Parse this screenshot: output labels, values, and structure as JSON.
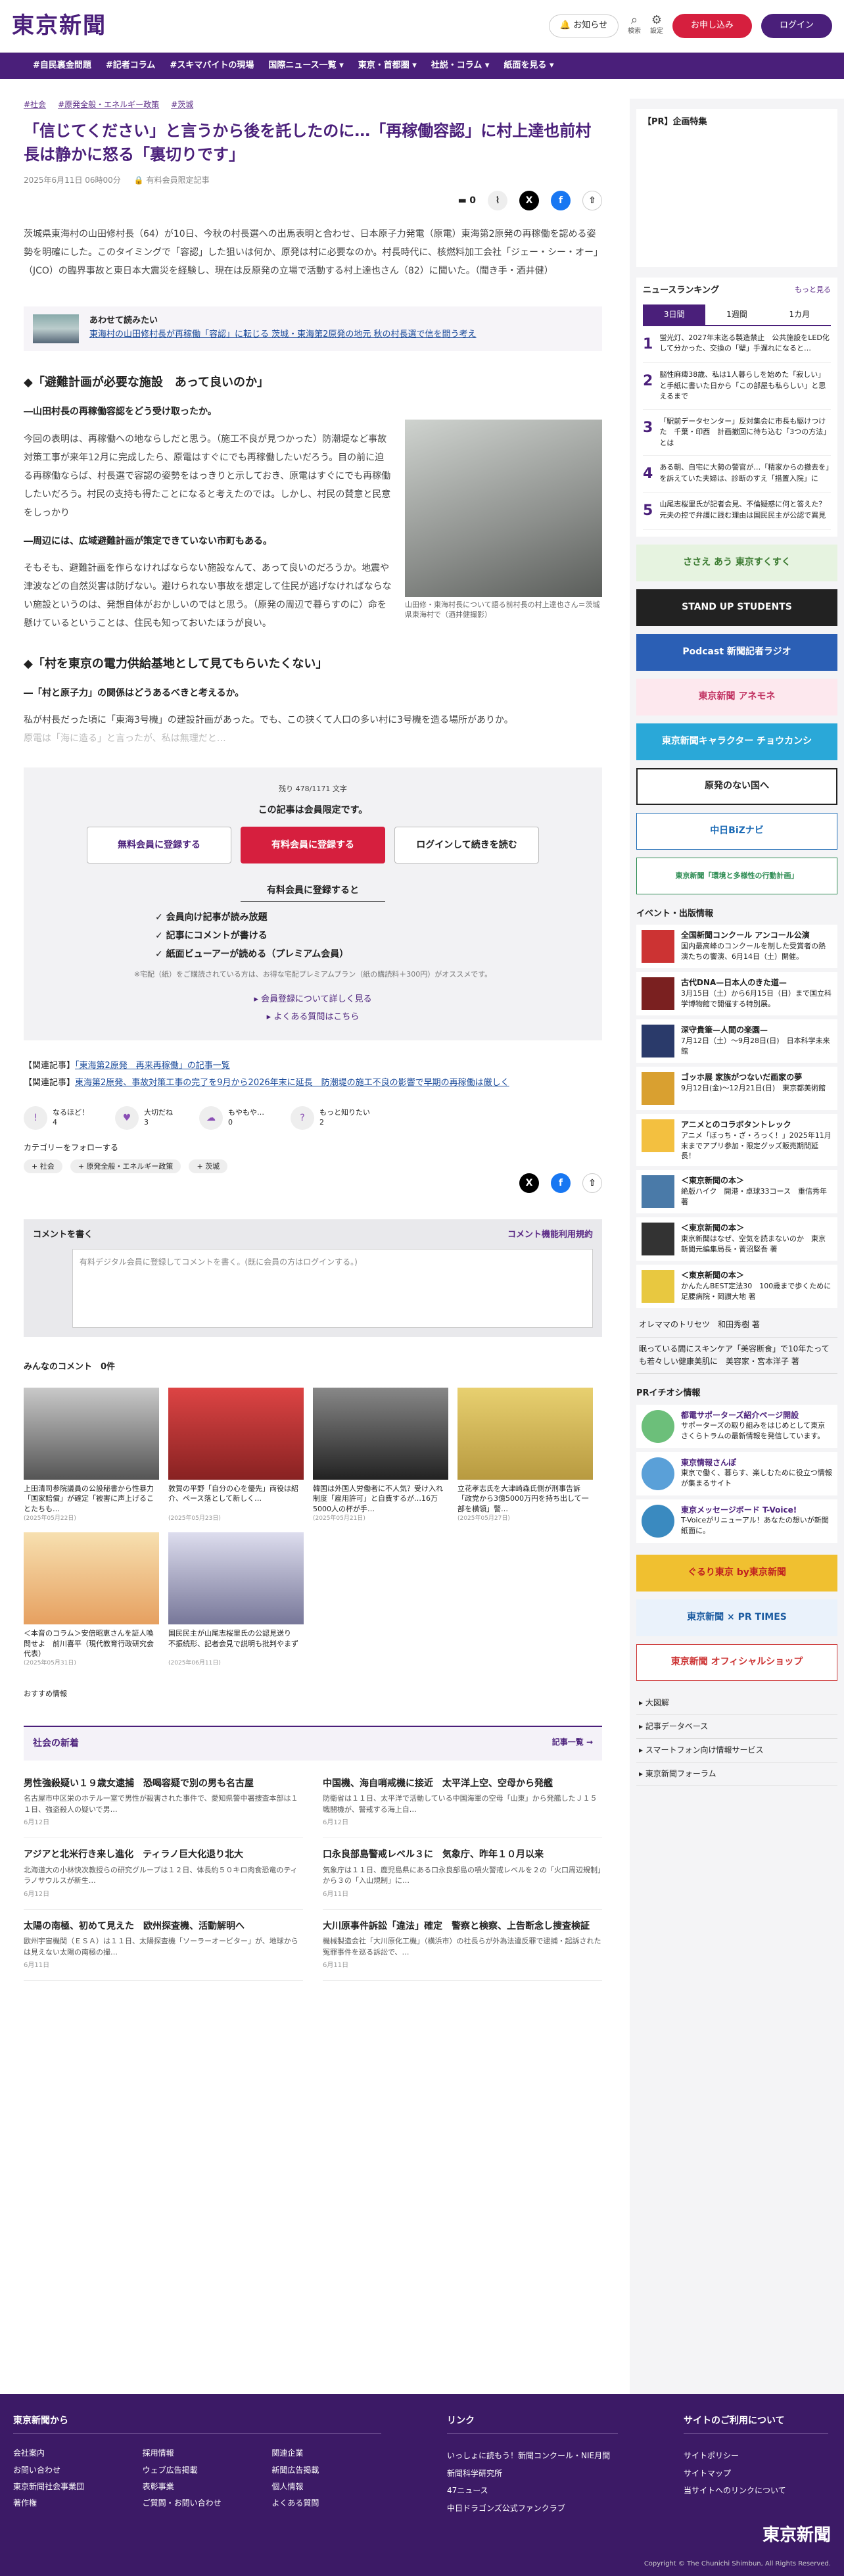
{
  "header": {
    "logo": "東京新聞",
    "notice": "お知らせ",
    "search": "検索",
    "settings": "設定",
    "register": "お申し込み",
    "login": "ログイン"
  },
  "nav": [
    "#自民裏金問題",
    "#記者コラム",
    "#スキマバイトの現場",
    "国際ニュース一覧 ▾",
    "東京・首都圏 ▾",
    "社説・コラム ▾",
    "紙面を見る ▾"
  ],
  "article": {
    "tags": [
      "#社会",
      "#原発全般・エネルギー政策",
      "#茨城"
    ],
    "title": "「信じてください」と言うから後を託したのに…「再稼働容認」に村上達也前村長は静かに怒る「裏切りです」",
    "date": "2025年6月11日 06時00分",
    "badge": "有料会員限定記事",
    "comment_count": "0",
    "lead": "茨城県東海村の山田修村長（64）が10日、今秋の村長選への出馬表明と合わせ、日本原子力発電（原電）東海第2原発の再稼働を認める姿勢を明確にした。このタイミングで「容認」した狙いは何か、原発は村に必要なのか。村長時代に、核燃料加工会社「ジェー・シー・オー」（JCO）の臨界事故と東日本大震災を経験し、現在は反原発の立場で活動する村上達也さん（82）に聞いた。（聞き手・酒井健）",
    "related_label": "あわせて読みたい",
    "related_title": "東海村の山田修村長が再稼働「容認」に転じる 茨城・東海第2原発の地元 秋の村長選で信を問う考え",
    "h2a": "◆「避難計画が必要な施設　あって良いのか」",
    "q1": "―山田村長の再稼働容認をどう受け取ったか。",
    "p1": "今回の表明は、再稼働への地ならしだと思う。（施工不良が見つかった）防潮堤など事故対策工事が来年12月に完成したら、原電はすぐにでも再稼働したいだろう。目の前に迫る再稼働ならば、村長選で容認の姿勢をはっきりと示しておき、原電はすぐにでも再稼働したいだろう。村民の支持も得たことになると考えたのでは。しかし、村民の賛意と民意をしっかり",
    "q2": "―周辺には、広域避難計画が策定できていない市町もある。",
    "p2": "そもそも、避難計画を作らなければならない施設なんて、あって良いのだろうか。地震や津波などの自然災害は防げない。避けられない事故を想定して住民が逃げなければならない施設というのは、発想自体がおかしいのではと思う。（原発の周辺で暮らすのに）命を懸けているということは、住民も知っておいたほうが良い。",
    "photo_caption": "山田修・東海村長について語る前村長の村上達也さん＝茨城県東海村で（酒井健撮影）",
    "h2b": "◆「村を東京の電力供給基地として見てもらいたくない」",
    "q3": "―「村と原子力」の関係はどうあるべきと考えるか。",
    "p3": "私が村長だった頃に「東海3号機」の建設計画があった。でも、この狭くて人口の多い村に3号機を造る場所がありか。",
    "p3_fade": "原電は「海に造る」と言ったが、私は無理だと…"
  },
  "paywall": {
    "remaining": "残り 478/1171 文字",
    "msg": "この記事は会員限定です。",
    "btn_free": "無料会員に登録する",
    "btn_paid": "有料会員に登録する",
    "btn_login": "ログインして続きを読む",
    "benefits_h": "有料会員に登録すると",
    "benefits": [
      "会員向け記事が読み放題",
      "記事にコメントが書ける",
      "紙面ビューアーが読める（プレミアム会員）"
    ],
    "note": "※宅配（紙）をご購読されている方は、お得な宅配プレミアムプラン（紙の購読料＋300円）がオススメです。",
    "link1": "会員登録について詳しく見る",
    "link2": "よくある質問はこちら"
  },
  "related_articles": {
    "a_label": "【関連記事】",
    "a_text": "「東海第2原発　再来再稼働」の記事一覧",
    "b_label": "【関連記事】",
    "b_text": "東海第2原発、事故対策工事の完了を9月から2026年末に延長　防潮堤の施工不良の影響で早期の再稼働は厳しく"
  },
  "reactions": [
    {
      "label": "なるほど！",
      "count": "4"
    },
    {
      "label": "大切だね",
      "count": "3"
    },
    {
      "label": "もやもや…",
      "count": "0"
    },
    {
      "label": "もっと知りたい",
      "count": "2"
    }
  ],
  "follow": {
    "heading": "カテゴリーをフォローする",
    "chips": [
      "社会",
      "原発全般・エネルギー政策",
      "茨城"
    ]
  },
  "comment": {
    "heading": "コメントを書く",
    "policy": "コメント機能利用規約",
    "placeholder": "有料デジタル会員に登録してコメントを書く。(既に会員の方はログインする。)"
  },
  "mycomments": {
    "heading": "みんなのコメント　0件",
    "items": [
      {
        "t": "上田清司参院議員の公設秘書から性暴力「国家賠償」が確定「被害に声上げることたちも…",
        "d": "(2025年05月22日)"
      },
      {
        "t": "敦賀の平野「自分の心を優先」両役は紹介、ペース落として新しく…",
        "d": "(2025年05月23日)"
      },
      {
        "t": "韓国は外国人労働者に不人気？受け入れ制度「雇用許可」と自費するが…16万5000人の杯が手…",
        "d": "(2025年05月21日)"
      },
      {
        "t": "立花孝志氏を大津崎森氏側が刑事告訴「政党から3億5000万円を持ち出して一部を横領」警…",
        "d": "(2025年05月27日)"
      },
      {
        "t": "＜本音のコラム＞安倍昭恵さんを証人喚問せよ　前川喜平（現代教育行政研究会代表）",
        "d": "(2025年05月31日)"
      },
      {
        "t": "国民民主が山尾志桜里氏の公認見送り　不振続形、記者会見で説明も批判やまず",
        "d": "(2025年06月11日)"
      }
    ]
  },
  "recommend": "おすすめ情報",
  "society": {
    "heading": "社会の新着",
    "more": "記事一覧 →",
    "items": [
      {
        "t": "男性強殺疑い１９歳女逮捕　恐喝容疑で別の男も名古屋",
        "b": "名古屋市中区栄のホテル一室で男性が殺害された事件で、愛知県警中署捜査本部は１１日、強盗殺人の疑いで男…",
        "d": "6月12日"
      },
      {
        "t": "中国機、海自哨戒機に接近　太平洋上空、空母から発艦",
        "b": "防衛省は１１日、太平洋で活動している中国海軍の空母「山東」から発艦したＪ１５戦闘機が、警戒する海上自…",
        "d": "6月12日"
      },
      {
        "t": "アジアと北米行き来し進化　ティラノ巨大化退り北大",
        "b": "北海道大の小林快次教授らの研究グループは１２日、体長約５０キロ肉食恐竜のティラノサウルスが新生…",
        "d": "6月12日"
      },
      {
        "t": "口永良部島警戒レベル３に　気象庁、昨年１０月以来",
        "b": "気象庁は１１日、鹿児島県にある口永良部島の噴火警戒レベルを２の「火口周辺規制」から３の「入山規制」に…",
        "d": "6月11日"
      },
      {
        "t": "太陽の南極、初めて見えた　欧州探査機、活動解明へ",
        "b": "欧州宇宙機関（ＥＳＡ）は１１日、太陽探査機「ソーラーオービター」が、地球からは見えない太陽の南極の撮…",
        "d": "6月11日"
      },
      {
        "t": "大川原事件訴訟「違法」確定　警察と検察、上告断念し捜査検証",
        "b": "機械製造会社「大川原化工機」（横浜市）の社長らが外為法違反罪で逮捕・起訴された冤罪事件を巡る訴訟で、…",
        "d": "6月11日"
      }
    ]
  },
  "side": {
    "pr_heading": "【PR】企画特集",
    "ranking_heading": "ニュースランキング",
    "ranking_more": "もっと見る",
    "ranking_tabs": [
      "3日間",
      "1週間",
      "1カ月"
    ],
    "ranking": [
      {
        "n": "1",
        "t": "蛍光灯、2027年末迄る製造禁止　公共施設をLED化して分かった、交換の「壁」手遅れになると…"
      },
      {
        "n": "2",
        "t": "脳性麻痺38歳、私は1人暮らしを始めた「寂しい」と手紙に書いた日から「この部屋も私らしい」と思えるまで"
      },
      {
        "n": "3",
        "t": "「駅前データセンター」反対集会に市長も駆けつけた　千葉・印西　計画撤回に待ち込む「3つの方法」とは"
      },
      {
        "n": "4",
        "t": "ある朝、自宅に大勢の警官が…「精家からの撤去を」を訴えていた夫婦は、診断のすえ「措置入院」に"
      },
      {
        "n": "5",
        "t": "山尾志桜里氏が記者会見、不倫疑惑に何と答えた？　元夫の控で弁護に践む理由は国民民主が公認で異見"
      }
    ],
    "banners": [
      "ささえ あう 東京すくすく",
      "STAND UP STUDENTS",
      "Podcast 新聞記者ラジオ",
      "東京新聞 アネモネ",
      "東京新聞キャラクター チョウカンシ",
      "原発のない国へ",
      "中日BiZナビ",
      "東京新聞「環境と多様性の行動計画」"
    ],
    "events_heading": "イベント・出版情報",
    "events": [
      {
        "b": "全国新聞コンクール アンコール公演",
        "t": "国内最高峰のコンクールを制した受賞者の熱演たちの饗演、6月14日（土）開催。"
      },
      {
        "b": "古代DNA—日本人のきた道—",
        "t": "3月15日（土）から6月15日（日）まで国立科学博物館で開催する特別展。"
      },
      {
        "b": "深守貴筆—人間の楽園—",
        "t": "7月12日（土）〜9月28日(日)　日本科学未来館"
      },
      {
        "b": "ゴッホ展 家族がつないだ画家の夢",
        "t": "9月12日(金)〜12月21日(日)　東京都美術館"
      },
      {
        "b": "アニメとのコラボタントレック",
        "t": "アニメ「ぼっち・ざ・ろっく！」2025年11月末までアプリ参加・限定グッズ販売期間延長！"
      },
      {
        "b": "＜東京新聞の本＞",
        "t": "絶版ハイク　開港・卓球33コース　重信秀年 著"
      },
      {
        "b": "＜東京新聞の本＞",
        "t": "東京新聞はなぜ、空気を読まないのか　東京新聞元編集局長・菅沼堅吾 著"
      },
      {
        "b": "＜東京新聞の本＞",
        "t": "かんたんBEST定法30　100歳まで歩くために　足腰病院・岡讃大地 著"
      }
    ],
    "links": [
      "オレママのトリセツ　和田秀樹 著",
      "眠っている間にスキンケア「美容断食」で10年たっても若々しい健康美肌に　美容家・宮本洋子 著"
    ],
    "pr_heading2": "PRイチオシ情報",
    "pr": [
      {
        "b": "都電サポーターズ紹介ページ開設",
        "t": "サポーターズの取り組みをはじめとして東京さくらトラムの最新情報を発信しています。"
      },
      {
        "b": "東京情報さんぽ",
        "t": "東京で働く、暮らす、楽しむために役立つ情報が集まるサイト"
      },
      {
        "b": "東京メッセージボード T-Voice!",
        "t": "T-Voiceがリニューアル！あなたの想いが新聞紙面に。"
      }
    ],
    "banners2": [
      "ぐるり東京 by東京新聞",
      "東京新聞 × PR TIMES",
      "東京新聞 オフィシャルショップ"
    ],
    "side_links": [
      "大図解",
      "記事データベース",
      "スマートフォン向け情報サービス",
      "東京新聞フォーラム"
    ]
  },
  "footer": {
    "col1_h": "東京新聞から",
    "col1": [
      "会社案内",
      "採用情報",
      "関連企業",
      "お問い合わせ",
      "ウェブ広告掲載",
      "新聞広告掲載",
      "東京新聞社会事業団",
      "表彰事業",
      "個人情報",
      "著作権",
      "ご質問・お問い合わせ",
      "よくある質問"
    ],
    "col2_h": "リンク",
    "col2": [
      "いっしょに読もう！新聞コンクール・NIE月間",
      "新聞科学研究所",
      "47ニュース",
      "中日ドラゴンズ公式ファンクラブ"
    ],
    "col3_h": "サイトのご利用について",
    "col3": [
      "サイトポリシー",
      "サイトマップ",
      "当サイトへのリンクについて"
    ],
    "logo": "東京新聞",
    "copyright": "Copyright © The Chunichi Shimbun, All Rights Reserved."
  }
}
